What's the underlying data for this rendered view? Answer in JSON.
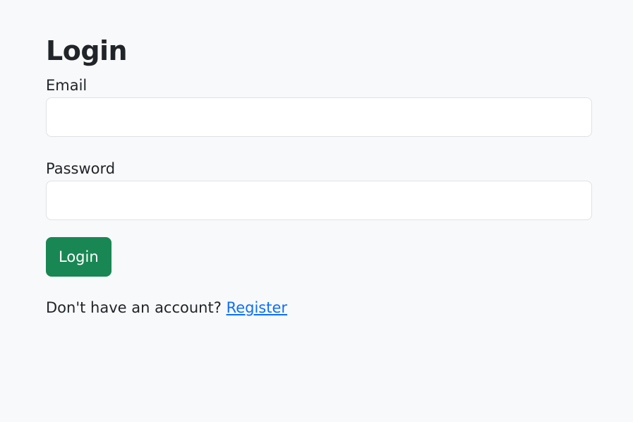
{
  "page": {
    "title": "Login"
  },
  "form": {
    "email_label": "Email",
    "email_value": "",
    "password_label": "Password",
    "password_value": "",
    "submit_label": "Login"
  },
  "footer": {
    "prompt_text": "Don't have an account? ",
    "register_link": "Register"
  },
  "colors": {
    "background": "#f8f9fa",
    "primary_button": "#198754",
    "link": "#0d6efd"
  }
}
